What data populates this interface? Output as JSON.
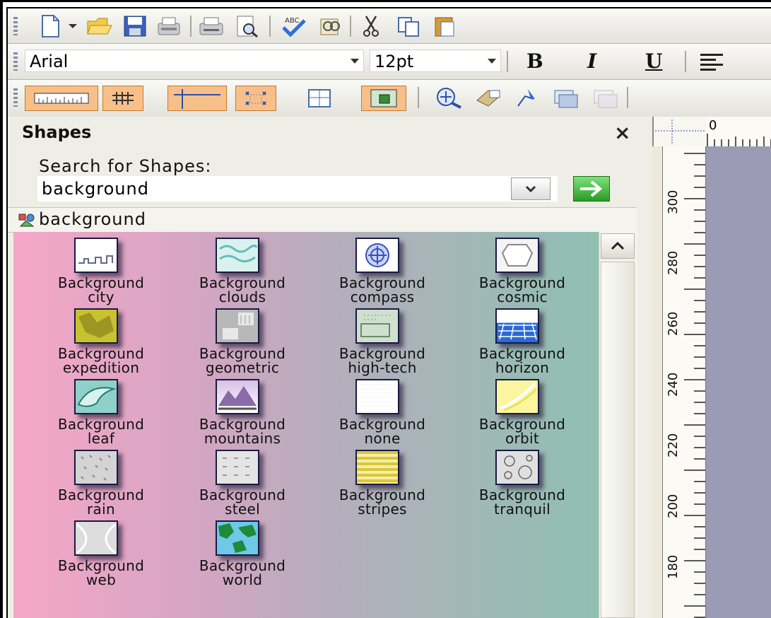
{
  "toolbar_standard": {
    "buttons": [
      "new-icon",
      "new-dropdown-icon",
      "open-icon",
      "save-icon",
      "permission-icon",
      "print-icon",
      "print-preview-icon",
      "spelling-icon",
      "research-icon",
      "cut-icon",
      "copy-icon",
      "paste-icon"
    ]
  },
  "toolbar_format": {
    "font": "Arial",
    "size": "12pt",
    "bold": "B",
    "italic": "I",
    "underline": "U"
  },
  "shapes_pane": {
    "title": "Shapes",
    "close": "×",
    "search_label": "Search for Shapes:",
    "search_value": "background",
    "stencil": "background",
    "items": [
      {
        "l1": "Background",
        "l2": "city"
      },
      {
        "l1": "Background",
        "l2": "clouds"
      },
      {
        "l1": "Background",
        "l2": "compass"
      },
      {
        "l1": "Background",
        "l2": "cosmic"
      },
      {
        "l1": "Background",
        "l2": "expedition"
      },
      {
        "l1": "Background",
        "l2": "geometric"
      },
      {
        "l1": "Background",
        "l2": "high-tech"
      },
      {
        "l1": "Background",
        "l2": "horizon"
      },
      {
        "l1": "Background",
        "l2": "leaf"
      },
      {
        "l1": "Background",
        "l2": "mountains"
      },
      {
        "l1": "Background",
        "l2": "none"
      },
      {
        "l1": "Background",
        "l2": "orbit"
      },
      {
        "l1": "Background",
        "l2": "rain"
      },
      {
        "l1": "Background",
        "l2": "steel"
      },
      {
        "l1": "Background",
        "l2": "stripes"
      },
      {
        "l1": "Background",
        "l2": "tranquil"
      },
      {
        "l1": "Background",
        "l2": "web"
      },
      {
        "l1": "Background",
        "l2": "world"
      }
    ]
  },
  "ruler": {
    "top_label": "0",
    "left_labels": [
      "300",
      "280",
      "260",
      "240",
      "220",
      "200",
      "180"
    ]
  }
}
